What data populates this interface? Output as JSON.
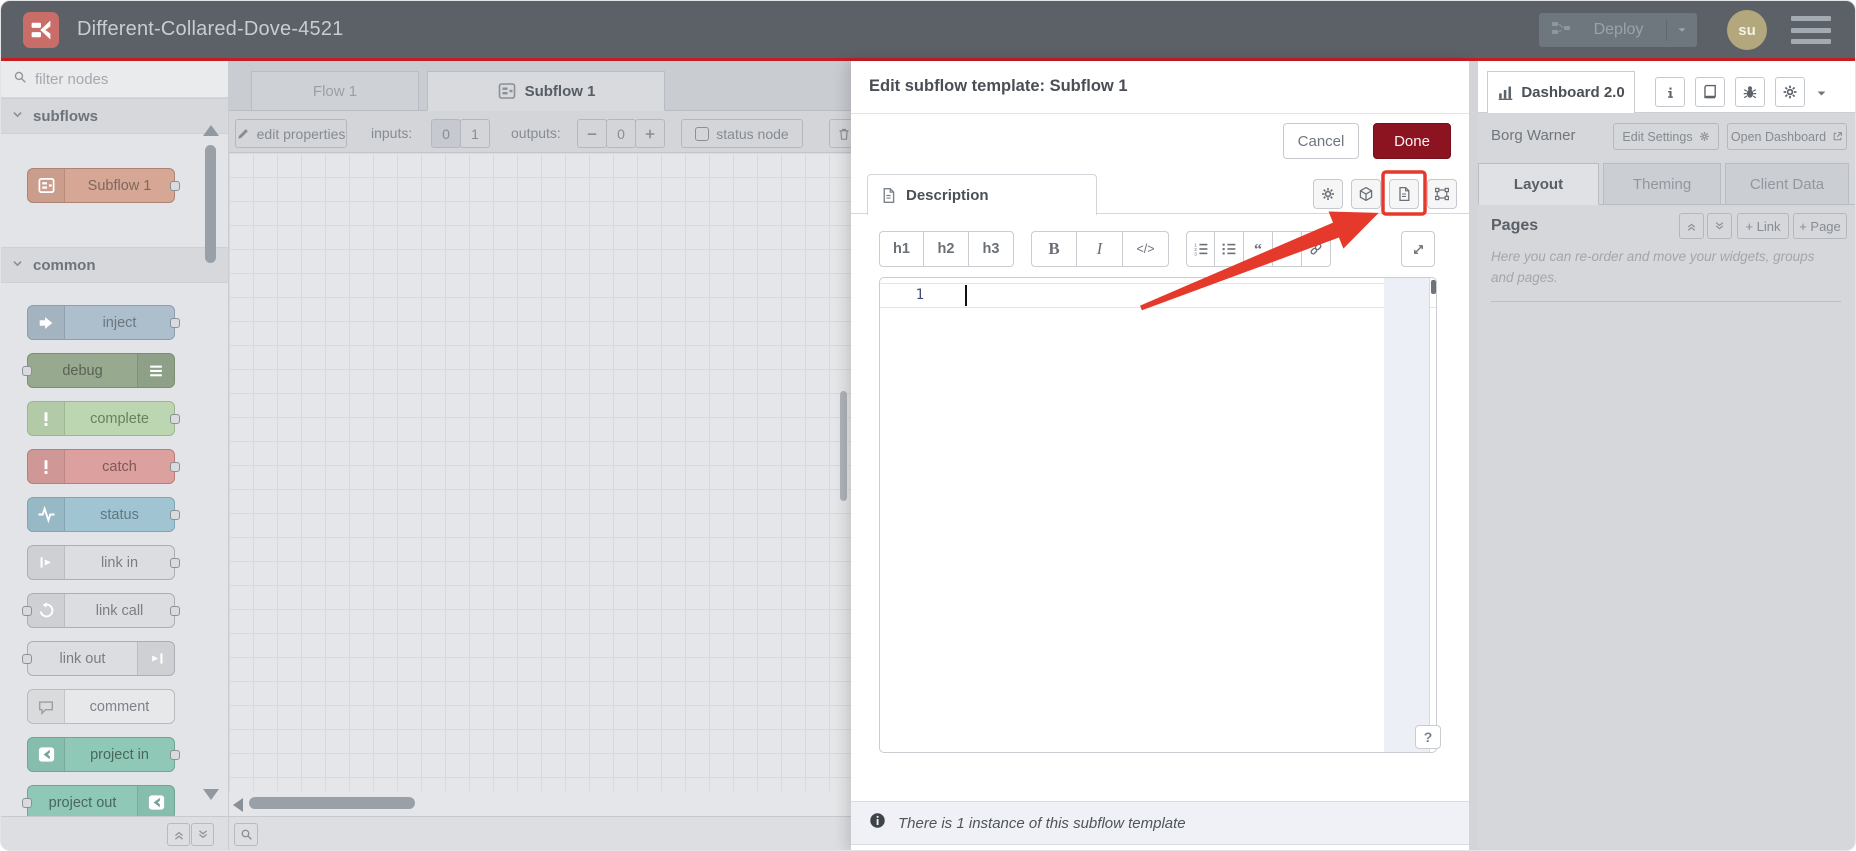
{
  "header": {
    "title": "Different-Collared-Dove-4521",
    "deploy_label": "Deploy",
    "avatar_initials": "su"
  },
  "palette": {
    "filter_placeholder": "filter nodes",
    "categories": [
      {
        "label": "subflows",
        "nodes": [
          {
            "label": "Subflow 1",
            "icon": "subflow-icon",
            "icon_side": "left",
            "bg": "#d7a795",
            "border": "#ad8373",
            "text": "#7e685c",
            "ports": "right"
          }
        ]
      },
      {
        "label": "common",
        "nodes": [
          {
            "label": "inject",
            "icon": "inject-icon",
            "icon_side": "left",
            "bg": "#adbecc",
            "border": "#8d9fae",
            "text": "#6d7680",
            "ports": "right"
          },
          {
            "label": "debug",
            "icon": "list-icon",
            "icon_side": "right",
            "bg": "#97aa8f",
            "border": "#7b8f72",
            "text": "#596353",
            "ports": "left"
          },
          {
            "label": "complete",
            "icon": "exclam-icon",
            "icon_side": "left",
            "bg": "#bdd6b2",
            "border": "#9cb591",
            "text": "#69805f",
            "ports": "right"
          },
          {
            "label": "catch",
            "icon": "exclam-icon",
            "icon_side": "left",
            "bg": "#dca09e",
            "border": "#bb7d7b",
            "text": "#7f5857",
            "ports": "right"
          },
          {
            "label": "status",
            "icon": "pulse-icon",
            "icon_side": "left",
            "bg": "#a0c4d1",
            "border": "#7fa6b5",
            "text": "#5d7883",
            "ports": "right"
          },
          {
            "label": "link in",
            "icon": "link-in-icon",
            "icon_side": "left",
            "bg": "#dcdde0",
            "border": "#abafb5",
            "text": "#797e85",
            "ports": "right"
          },
          {
            "label": "link call",
            "icon": "link-call-icon",
            "icon_side": "left",
            "bg": "#dcdde0",
            "border": "#abafb5",
            "text": "#797e85",
            "ports": "both"
          },
          {
            "label": "link out",
            "icon": "link-out-icon",
            "icon_side": "right",
            "bg": "#dcdde0",
            "border": "#abafb5",
            "text": "#797e85",
            "ports": "left"
          },
          {
            "label": "comment",
            "icon": "comment-icon",
            "icon_side": "left",
            "bg": "#e7e8ea",
            "border": "#b8bbc0",
            "text": "#7d8289",
            "ports": "none"
          },
          {
            "label": "project in",
            "icon": "project-icon",
            "icon_side": "left",
            "bg": "#8fc8b6",
            "border": "#6ea693",
            "text": "#49685c",
            "ports": "right"
          },
          {
            "label": "project out",
            "icon": "project-icon",
            "icon_side": "right",
            "bg": "#8fc8b6",
            "border": "#6ea693",
            "text": "#49685c",
            "ports": "left"
          }
        ]
      }
    ]
  },
  "workspace": {
    "tabs": [
      {
        "label": "Flow 1",
        "active": false
      },
      {
        "label": "Subflow 1",
        "active": true
      }
    ],
    "toolbar": {
      "edit_properties_label": "edit properties",
      "inputs_label": "inputs:",
      "input_options": [
        "0",
        "1"
      ],
      "selected_input": "0",
      "outputs_label": "outputs:",
      "output_value": "0",
      "status_node_label": "status node"
    }
  },
  "tray": {
    "title": "Edit subflow template: Subflow 1",
    "cancel_label": "Cancel",
    "done_label": "Done",
    "description_tab_label": "Description",
    "editor": {
      "line_number": "1",
      "help_button": "?"
    },
    "toolbar_groups": [
      [
        {
          "id": "h1",
          "label": "h1"
        },
        {
          "id": "h2",
          "label": "h2"
        },
        {
          "id": "h3",
          "label": "h3"
        }
      ],
      [
        {
          "id": "bold",
          "label": "B"
        },
        {
          "id": "italic",
          "label": "I"
        },
        {
          "id": "code",
          "label": "</>"
        }
      ],
      [
        {
          "id": "ordered-list"
        },
        {
          "id": "unordered-list"
        },
        {
          "id": "quote"
        },
        {
          "id": "horizontal-rule"
        },
        {
          "id": "link"
        }
      ]
    ],
    "footer_text": "There is 1 instance of this subflow template"
  },
  "sidebar": {
    "dashboard_tab_label": "Dashboard 2.0",
    "header_icon_buttons": [
      "info",
      "book",
      "bug",
      "gear"
    ],
    "project_name": "Borg Warner",
    "edit_settings_label": "Edit Settings",
    "open_dashboard_label": "Open Dashboard",
    "tabs": [
      {
        "label": "Layout",
        "active": true
      },
      {
        "label": "Theming",
        "active": false
      },
      {
        "label": "Client Data",
        "active": false
      }
    ],
    "pages": {
      "title": "Pages",
      "add_link_label": "+ Link",
      "add_page_label": "+ Page",
      "help_text": "Here you can re-order and move your widgets, groups and pages."
    }
  },
  "colors": {
    "header_bg": "#5b6167",
    "accent_red_line": "#c41e25",
    "done_button": "#8b1420",
    "annotation_red": "#e5392b",
    "avatar_bg": "#b3a87d"
  }
}
